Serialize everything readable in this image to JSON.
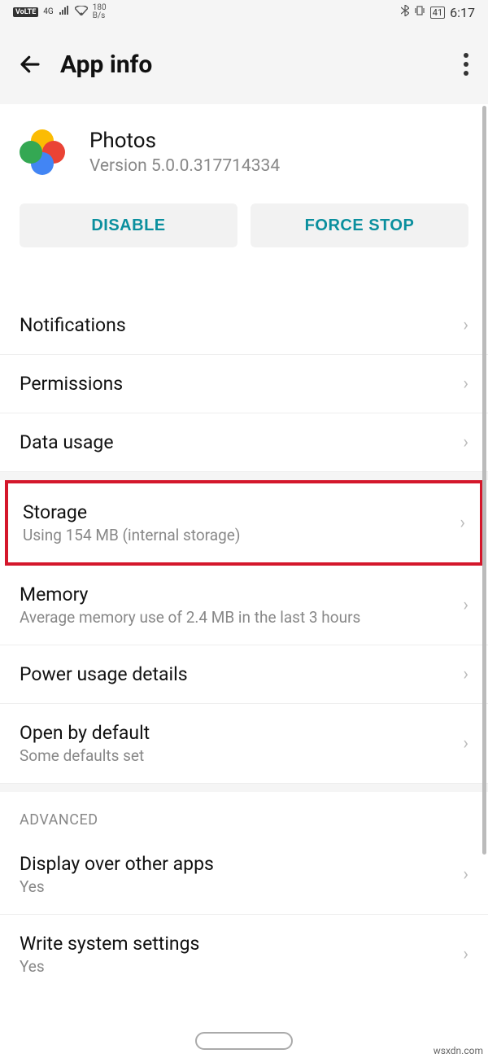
{
  "status": {
    "volte": "VoLTE",
    "net": "4G",
    "speed_top": "180",
    "speed_bot": "B/s",
    "battery": "41",
    "time": "6:17"
  },
  "header": {
    "title": "App info"
  },
  "app": {
    "name": "Photos",
    "version": "Version 5.0.0.317714334"
  },
  "buttons": {
    "disable": "DISABLE",
    "force_stop": "FORCE STOP"
  },
  "items": {
    "notifications": "Notifications",
    "permissions": "Permissions",
    "data_usage": "Data usage",
    "storage": "Storage",
    "storage_sub": "Using 154 MB (internal storage)",
    "memory": "Memory",
    "memory_sub": "Average memory use of 2.4 MB in the last 3 hours",
    "power": "Power usage details",
    "open_default": "Open by default",
    "open_default_sub": "Some defaults set",
    "advanced": "ADVANCED",
    "display_over": "Display over other apps",
    "display_over_sub": "Yes",
    "write_sys": "Write system settings",
    "write_sys_sub": "Yes"
  },
  "watermark": "wsxdn.com"
}
